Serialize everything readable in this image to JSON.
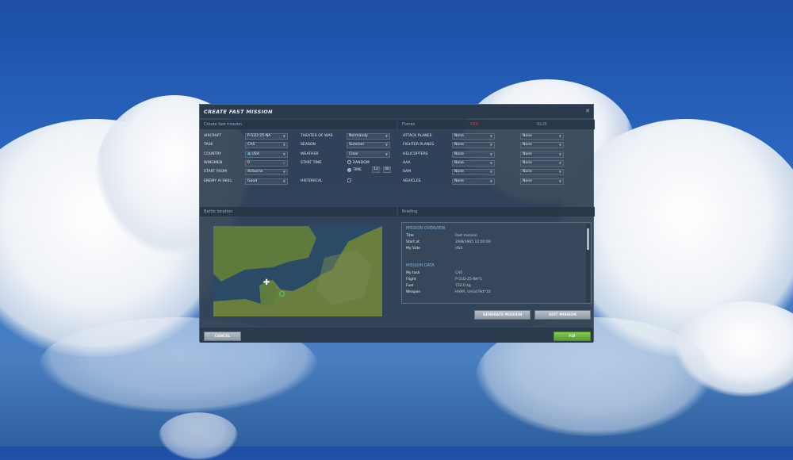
{
  "dialog": {
    "title": "CREATE FAST MISSION"
  },
  "mission": {
    "section": "Create fast mission",
    "left": [
      {
        "label": "AIRCRAFT",
        "value": "P-51D-25-NA"
      },
      {
        "label": "TASK",
        "value": "CAS"
      },
      {
        "label": "COUNTRY",
        "value": "USA"
      },
      {
        "label": "WINGMEN",
        "value": "0"
      },
      {
        "label": "START FROM",
        "value": "Airborne"
      },
      {
        "label": "ENEMY AI SKILL",
        "value": "Good"
      }
    ],
    "right": {
      "theater_label": "THEATER OF WAR",
      "theater": "Normandy",
      "season_label": "SEASON",
      "season": "Summer",
      "weather_label": "WEATHER",
      "weather": "Clear",
      "start_time_label": "START TIME",
      "random_label": "RANDOM",
      "time_label": "TIME",
      "hour": "12",
      "minute": "00",
      "historical_label": "HISTORICAL",
      "historical_checked": false,
      "time_mode": "TIME"
    }
  },
  "forces": {
    "section": "Forces",
    "red": "RED",
    "blue": "BLUE",
    "red_color": "#d23a2a",
    "blue_color": "#3fa9d8",
    "rows": [
      {
        "label": "ATTACK PLANES",
        "red": "None",
        "blue": "None"
      },
      {
        "label": "FIGHTER PLANES",
        "red": "None",
        "blue": "None"
      },
      {
        "label": "HELICOPTERS",
        "red": "None",
        "blue": "None"
      },
      {
        "label": "AAA",
        "red": "None",
        "blue": "None"
      },
      {
        "label": "SAM",
        "red": "None",
        "blue": "None"
      },
      {
        "label": "VEHICLES",
        "red": "None",
        "blue": "None"
      }
    ]
  },
  "battle": {
    "section": "Battle location",
    "map_icons": [
      "aircraft-icon",
      "target-icon"
    ]
  },
  "briefing": {
    "section": "Briefing",
    "overview_title": "MISSION OVERVIEW",
    "overview": [
      {
        "k": "Title",
        "v": "Fast mission"
      },
      {
        "k": "Start at",
        "v": "29/8/1965  12:00:00"
      },
      {
        "k": "My Side",
        "v": "USA"
      }
    ],
    "data_title": "MISSION DATA",
    "data": [
      {
        "k": "My task",
        "v": "CAS"
      },
      {
        "k": "Flight",
        "v": "P-51D-25-NA*1"
      },
      {
        "k": "Fuel",
        "v": "732.0 kg"
      },
      {
        "k": "Weapon",
        "v": "HVAR, UnGd Rkt*10"
      }
    ]
  },
  "buttons": {
    "generate": "GENERATE MISSION",
    "edit": "EDIT MISSION",
    "cancel": "CANCEL",
    "fly": "FLY",
    "fly_color": "#6db33f"
  }
}
